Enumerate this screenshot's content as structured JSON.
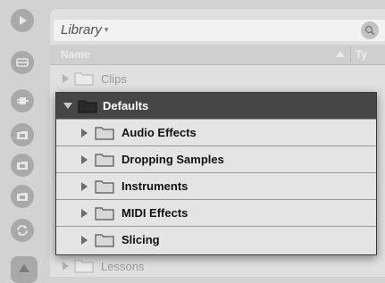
{
  "sidebar": {
    "icons": [
      "play-icon",
      "clip-icon",
      "plugin-icon",
      "folder-icon",
      "folder-icon",
      "folder-icon",
      "refresh-icon"
    ],
    "collapse_icon": "triangle-up-icon"
  },
  "browser": {
    "title": "Library",
    "title_arrow": "▾",
    "columns": {
      "name": "Name",
      "type": "Ty"
    },
    "rows_before": [
      {
        "label": "Clips"
      }
    ],
    "expanded": {
      "label": "Defaults",
      "children": [
        {
          "label": "Audio Effects"
        },
        {
          "label": "Dropping Samples"
        },
        {
          "label": "Instruments"
        },
        {
          "label": "MIDI Effects"
        },
        {
          "label": "Slicing"
        }
      ]
    },
    "rows_after": [
      {
        "label": "Lessons"
      }
    ]
  },
  "colors": {
    "background": "#d2d2d2",
    "panel": "#e0e0e0",
    "selected_header": "#464646"
  }
}
